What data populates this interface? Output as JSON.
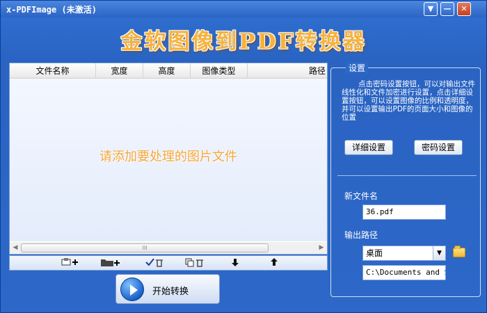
{
  "window": {
    "title": "x-PDFImage (未激活)"
  },
  "titlebar": {
    "dropdown_glyph": "▼",
    "minimize_glyph": "—",
    "close_glyph": "✕"
  },
  "banner": {
    "title": "金软图像到PDF转换器"
  },
  "list": {
    "columns": [
      "文件名称",
      "宽度",
      "高度",
      "图像类型",
      "路径"
    ],
    "empty_hint": "请添加要处理的图片文件",
    "scroll_left": "◀",
    "scroll_right": "▶",
    "scroll_grip": "III"
  },
  "toolbar": {
    "items": [
      {
        "name": "add-file",
        "icon": "add-file-icon"
      },
      {
        "name": "add-folder",
        "icon": "add-folder-icon"
      },
      {
        "name": "delete-selected",
        "icon": "check-delete-icon"
      },
      {
        "name": "delete-all",
        "icon": "copy-delete-icon"
      },
      {
        "name": "move-down",
        "icon": "arrow-down-icon"
      },
      {
        "name": "move-up",
        "icon": "arrow-up-icon"
      }
    ]
  },
  "start": {
    "label": "开始转换"
  },
  "settings": {
    "legend": "设置",
    "description": "点击密码设置按钮，可以对输出文件线性化和文件加密进行设置，点击详细设置按钮，可以设置图像的比例和透明度，并可以设置输出PDF的页面大小和图像的位置",
    "detail_button": "详细设置",
    "password_button": "密码设置",
    "new_filename_label": "新文件名",
    "new_filename_value": "36.pdf",
    "output_path_label": "输出路径",
    "output_location": "桌面",
    "output_path_value": "C:\\Documents and Se"
  }
}
